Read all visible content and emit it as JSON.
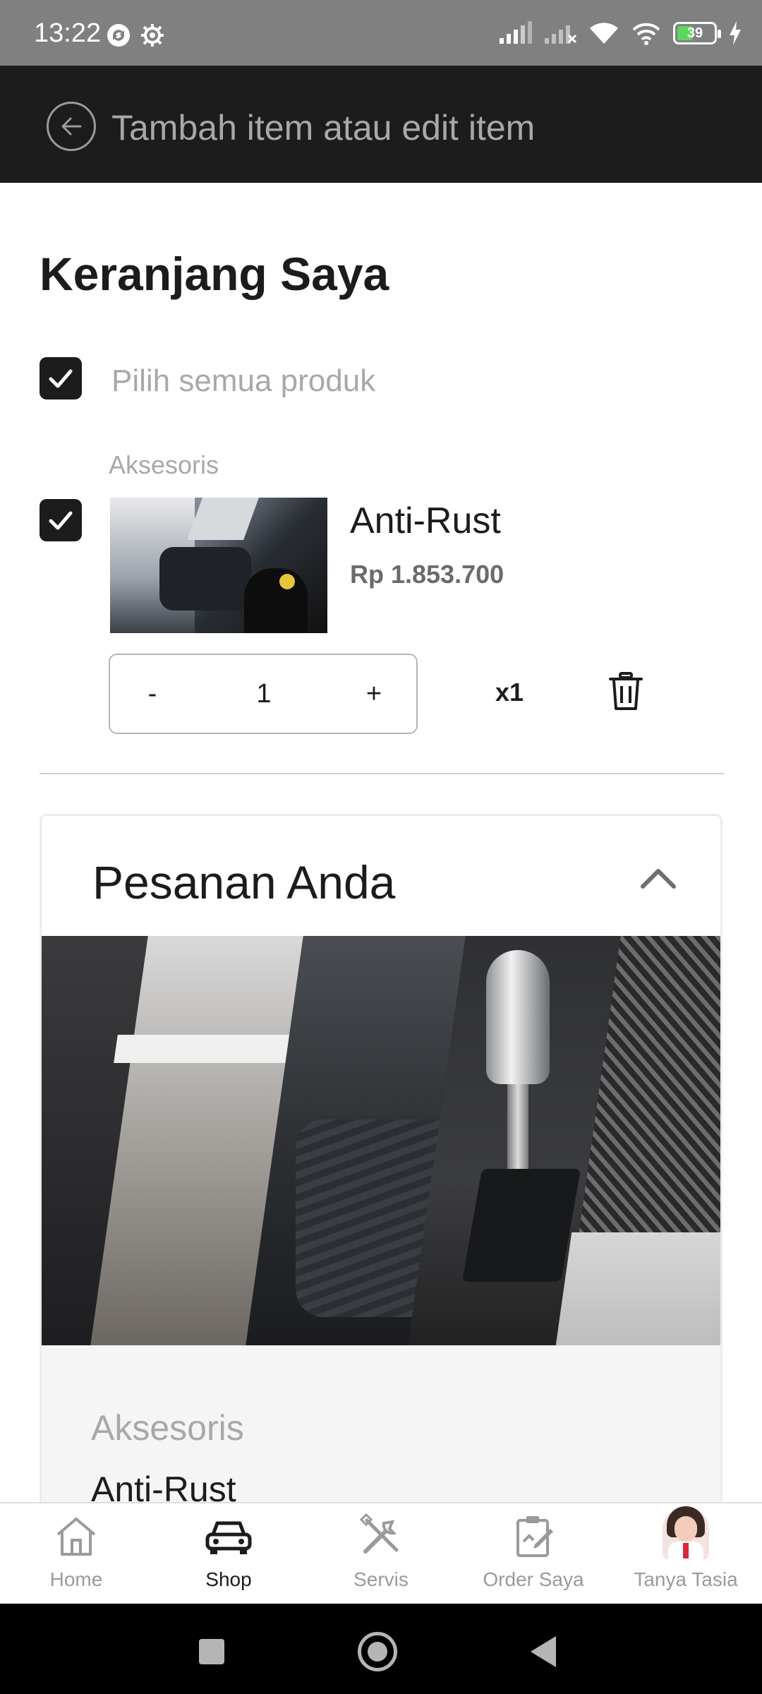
{
  "status_bar": {
    "time": "13:22",
    "battery_level": "39"
  },
  "app_bar": {
    "title": "Tambah item atau edit item"
  },
  "cart": {
    "title": "Keranjang Saya",
    "select_all_label": "Pilih semua produk",
    "select_all_checked": true,
    "items": [
      {
        "category": "Aksesoris",
        "checked": true,
        "name": "Anti-Rust",
        "price": "Rp 1.853.700",
        "quantity": "1",
        "qty_minus": "-",
        "qty_plus": "+",
        "multiplier": "x1"
      }
    ]
  },
  "order_panel": {
    "title": "Pesanan Anda",
    "expanded": true,
    "category": "Aksesoris",
    "item_name": "Anti-Rust"
  },
  "bottom_nav": {
    "items": [
      {
        "label": "Home",
        "icon": "home-icon",
        "active": false
      },
      {
        "label": "Shop",
        "icon": "car-icon",
        "active": true
      },
      {
        "label": "Servis",
        "icon": "tools-icon",
        "active": false
      },
      {
        "label": "Order Saya",
        "icon": "clipboard-icon",
        "active": false
      },
      {
        "label": "Tanya Tasia",
        "icon": "assistant-avatar",
        "active": false
      }
    ]
  },
  "colors": {
    "app_bar_bg": "#1c1c1c",
    "status_bar_bg": "#808080",
    "muted_text": "#a8a8a8",
    "price_text": "#6b6b6b",
    "panel_bg": "#f6f5f6",
    "battery_fill": "#5cd65c"
  }
}
